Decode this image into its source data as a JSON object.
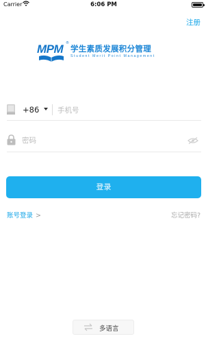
{
  "status_bar": {
    "carrier": "Carrier",
    "time": "6:06 PM",
    "battery_level": 1.0
  },
  "header": {
    "register_label": "注册"
  },
  "logo": {
    "mark_text": "MPM",
    "registered_mark": "®",
    "title": "学生素质发展积分管理",
    "subtitle": "Student Merit Point Management"
  },
  "form": {
    "country_code": "+86",
    "phone_placeholder": "手机号",
    "password_placeholder": "密码"
  },
  "actions": {
    "login_label": "登录",
    "account_login_label": "账号登录",
    "account_login_chevron": ">",
    "forgot_password_label": "忘记密码?"
  },
  "footer": {
    "language_label": "多语言"
  },
  "colors": {
    "accent": "#1fb0ee",
    "link": "#1aa7e8",
    "logo": "#1d86d6"
  },
  "icons": {
    "phone": "phone-icon",
    "lock": "lock-icon",
    "eye": "eye-hidden-icon",
    "wifi": "wifi-icon",
    "swap": "swap-arrows-icon",
    "dropdown": "caret-down-icon"
  }
}
